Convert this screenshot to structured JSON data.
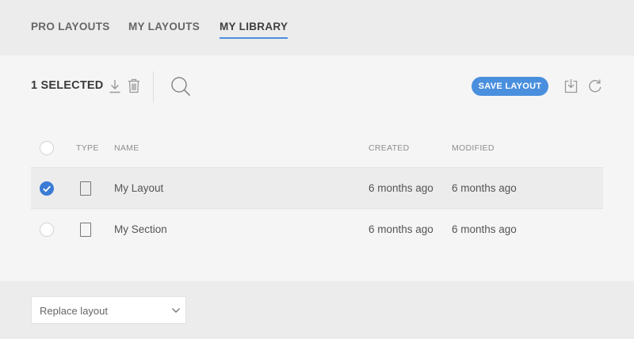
{
  "tabs": [
    {
      "label": "PRO LAYOUTS",
      "active": false
    },
    {
      "label": "MY LAYOUTS",
      "active": false
    },
    {
      "label": "MY LIBRARY",
      "active": true
    }
  ],
  "toolbar": {
    "selected_count": "1 SELECTED",
    "save_label": "SAVE LAYOUT",
    "icons": [
      "download-icon",
      "trash-icon",
      "search-icon",
      "import-icon",
      "refresh-icon"
    ]
  },
  "table": {
    "columns": {
      "type": "TYPE",
      "name": "NAME",
      "created": "CREATED",
      "modified": "MODIFIED"
    },
    "rows": [
      {
        "selected": true,
        "type_icon": "page-icon",
        "name": "My Layout",
        "created": "6 months ago",
        "modified": "6 months ago"
      },
      {
        "selected": false,
        "type_icon": "page-icon",
        "name": "My Section",
        "created": "6 months ago",
        "modified": "6 months ago"
      }
    ]
  },
  "footer": {
    "select_value": "Replace layout"
  },
  "colors": {
    "accent": "#4a8fde",
    "checked": "#3a7bd5"
  }
}
